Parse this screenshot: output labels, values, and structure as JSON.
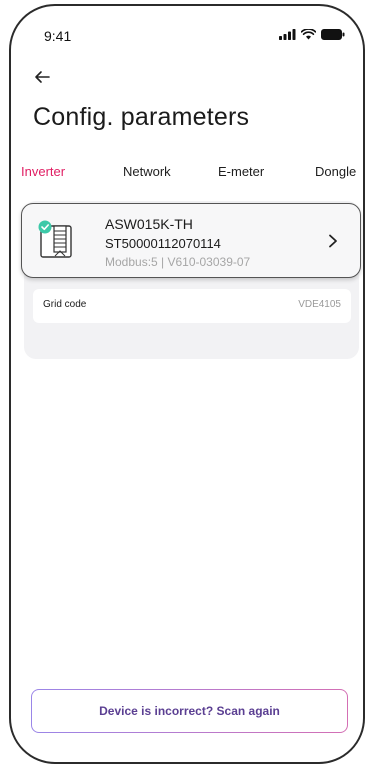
{
  "status_bar": {
    "time": "9:41"
  },
  "header": {
    "title": "Config. parameters"
  },
  "tabs": [
    {
      "label": "Inverter",
      "active": true
    },
    {
      "label": "Network",
      "active": false
    },
    {
      "label": "E-meter",
      "active": false
    },
    {
      "label": "Dongle",
      "active": false
    }
  ],
  "device": {
    "model": "ASW015K-TH",
    "serial": "ST50000112070114",
    "modbus": "Modbus:5 | V610-03039-07",
    "status_icon": "check-circle-icon"
  },
  "parameters": [
    {
      "name": "Grid code",
      "value": "VDE4105"
    }
  ],
  "actions": {
    "scan_again_label": "Device is incorrect? Scan again"
  },
  "colors": {
    "tab_active": "#e01e63",
    "status_ok": "#3cc9a8",
    "button_gradient_start": "#9a86e8",
    "button_gradient_end": "#d46fb4",
    "button_text": "#5b3f92"
  }
}
